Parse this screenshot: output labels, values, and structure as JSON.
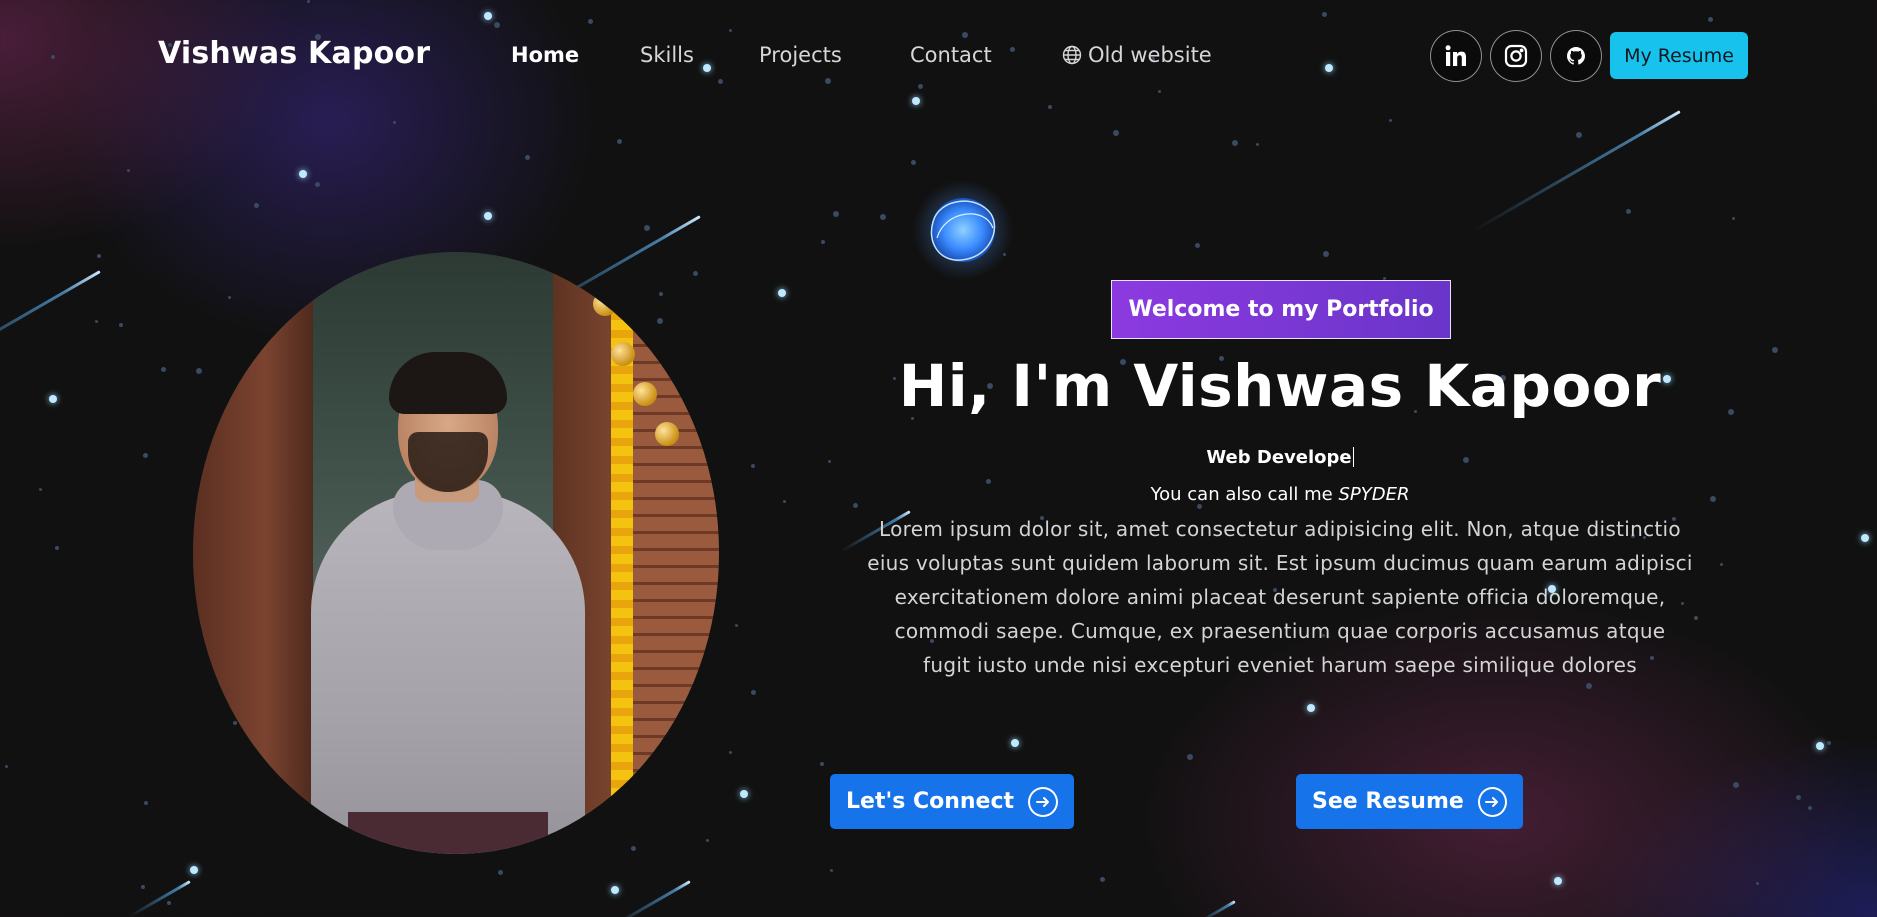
{
  "nav": {
    "brand": "Vishwas Kapoor",
    "links": [
      {
        "label": "Home",
        "active": true
      },
      {
        "label": "Skills"
      },
      {
        "label": "Projects"
      },
      {
        "label": "Contact"
      },
      {
        "label": "Old website",
        "icon": "globe-icon"
      }
    ],
    "social": [
      {
        "name": "linkedin",
        "icon": "linkedin-icon"
      },
      {
        "name": "instagram",
        "icon": "instagram-icon"
      },
      {
        "name": "github",
        "icon": "github-icon"
      }
    ],
    "resume_button": "My Resume"
  },
  "hero": {
    "badge": "Welcome to my Portfolio",
    "title": "Hi, I'm Vishwas Kapoor",
    "typed_role": "Web Develope",
    "alias_prefix": "You can also call me",
    "alias_name": "SPYDER",
    "about_lines": [
      "Lorem ipsum dolor sit, amet consectetur adipisicing elit. Non, atque distinctio",
      "eius voluptas sunt quidem laborum sit. Est ipsum ducimus quam earum adipisci",
      "exercitationem dolore animi placeat deserunt sapiente officia doloremque,",
      "commodi saepe. Cumque, ex praesentium quae corporis accusamus atque",
      "fugit iusto unde nisi excepturi eveniet harum saepe similique dolores"
    ],
    "connect_button": "Let's Connect",
    "see_resume_button": "See Resume",
    "portrait_icon": "profile-photo"
  },
  "colors": {
    "background": "#111111",
    "accent_cyan": "#17c3ec",
    "cta_blue": "#1673ea",
    "badge_purple": "#8c3ae0"
  }
}
